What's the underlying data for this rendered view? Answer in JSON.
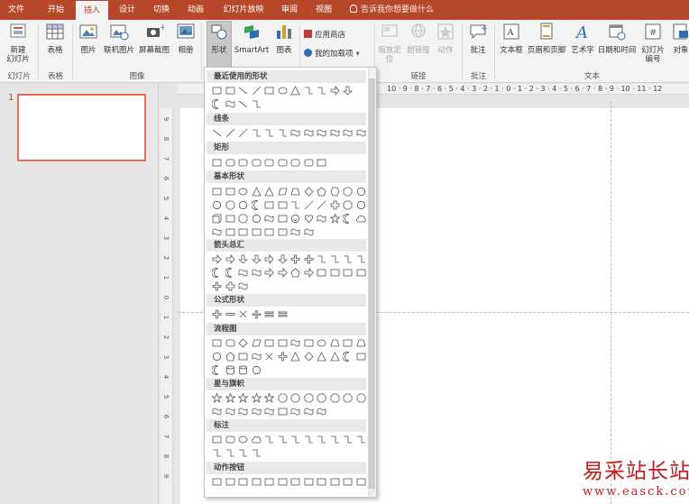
{
  "tabs": [
    {
      "label": "文件",
      "active": false
    },
    {
      "label": "开始",
      "active": false
    },
    {
      "label": "插入",
      "active": true
    },
    {
      "label": "设计",
      "active": false
    },
    {
      "label": "切换",
      "active": false
    },
    {
      "label": "动画",
      "active": false
    },
    {
      "label": "幻灯片放映",
      "active": false
    },
    {
      "label": "审阅",
      "active": false
    },
    {
      "label": "视图",
      "active": false
    }
  ],
  "tell_me": "告诉我你想要做什么",
  "ribbon": {
    "new_slide_l1": "新建",
    "new_slide_l2": "幻灯片",
    "table": "表格",
    "picture": "图片",
    "online_picture": "联机图片",
    "screenshot": "屏幕截图",
    "album": "相册",
    "shapes": "形状",
    "smartart": "SmartArt",
    "chart": "图表",
    "app_store": "应用商店",
    "my_addins": "我的加载项",
    "zoom_l1": "缩放定",
    "zoom_l2": "位",
    "hyperlink": "超链接",
    "action": "动作",
    "comment": "批注",
    "textbox": "文本框",
    "header_footer": "页眉和页脚",
    "wordart": "艺术字",
    "datetime": "日期和时间",
    "slide_number_l1": "幻灯片",
    "slide_number_l2": "编号",
    "object": "对象"
  },
  "group_labels": {
    "slides": "幻灯片",
    "tables": "表格",
    "images": "图像",
    "links": "链接",
    "comments": "批注",
    "text": "文本"
  },
  "shapes_panel": {
    "sections": [
      "最近使用的形状",
      "线条",
      "矩形",
      "基本形状",
      "箭头总汇",
      "公式形状",
      "流程图",
      "星与旗帜",
      "标注",
      "动作按钮"
    ]
  },
  "ruler_h": "10 · 9 · 8 · 7 · 6 · 5 · 4 · 3 · 2 · 1 · 0 · 1 · 2 · 3 · 4 · 5 · 6 · 7 · 8 · 9 · 10 · 11 · 12",
  "ruler_v": [
    "9",
    "8",
    "7",
    "6",
    "5",
    "4",
    "3",
    "2",
    "1",
    "0",
    "1",
    "2",
    "3",
    "4",
    "5",
    "6",
    "7",
    "8",
    "9"
  ],
  "slide_thumb_number": "1",
  "watermark": {
    "cn": "易采站长站",
    "url": "www.easck.com"
  },
  "colors": {
    "accent": "#b7472a",
    "thumb_border": "#e5705a",
    "watermark": "#c21a1a"
  }
}
